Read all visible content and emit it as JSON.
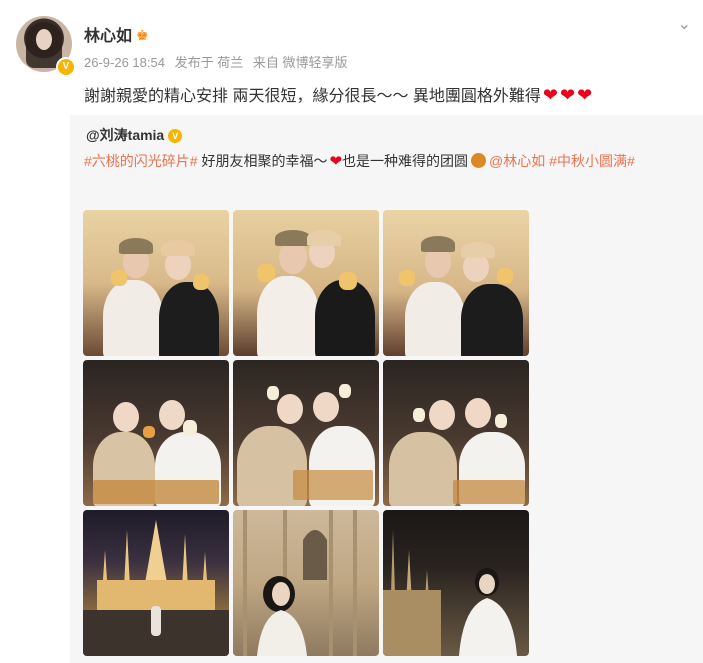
{
  "post": {
    "username": "林心如",
    "meta": [
      "26-9-26 18:54",
      "发布于 荷兰",
      "来自 微博轻享版"
    ],
    "text": "謝謝親愛的精心安排 兩天很短，緣分很長～～ 異地團圓格外難得"
  },
  "repost": {
    "username": "@刘涛tamia",
    "tag1": "#六桃的闪光碎片#",
    "text1": " 好朋友相聚的幸福～",
    "text2": "也是一种难得的团圆",
    "mention": "@林心如",
    "tag2": "#中秋小圆满#"
  },
  "photos": [
    {
      "scene": "dinner-caps"
    },
    {
      "scene": "dinner-kiss"
    },
    {
      "scene": "dinner-caps"
    },
    {
      "scene": "mooncake-night"
    },
    {
      "scene": "mooncake-night"
    },
    {
      "scene": "mooncake-night"
    },
    {
      "scene": "cathedral-night-wide"
    },
    {
      "scene": "cathedral-portrait"
    },
    {
      "scene": "cathedral-portrait-white"
    }
  ],
  "colors": {
    "link": "#eb7350",
    "heart": "#e8001c",
    "badge": "#f7b500"
  }
}
